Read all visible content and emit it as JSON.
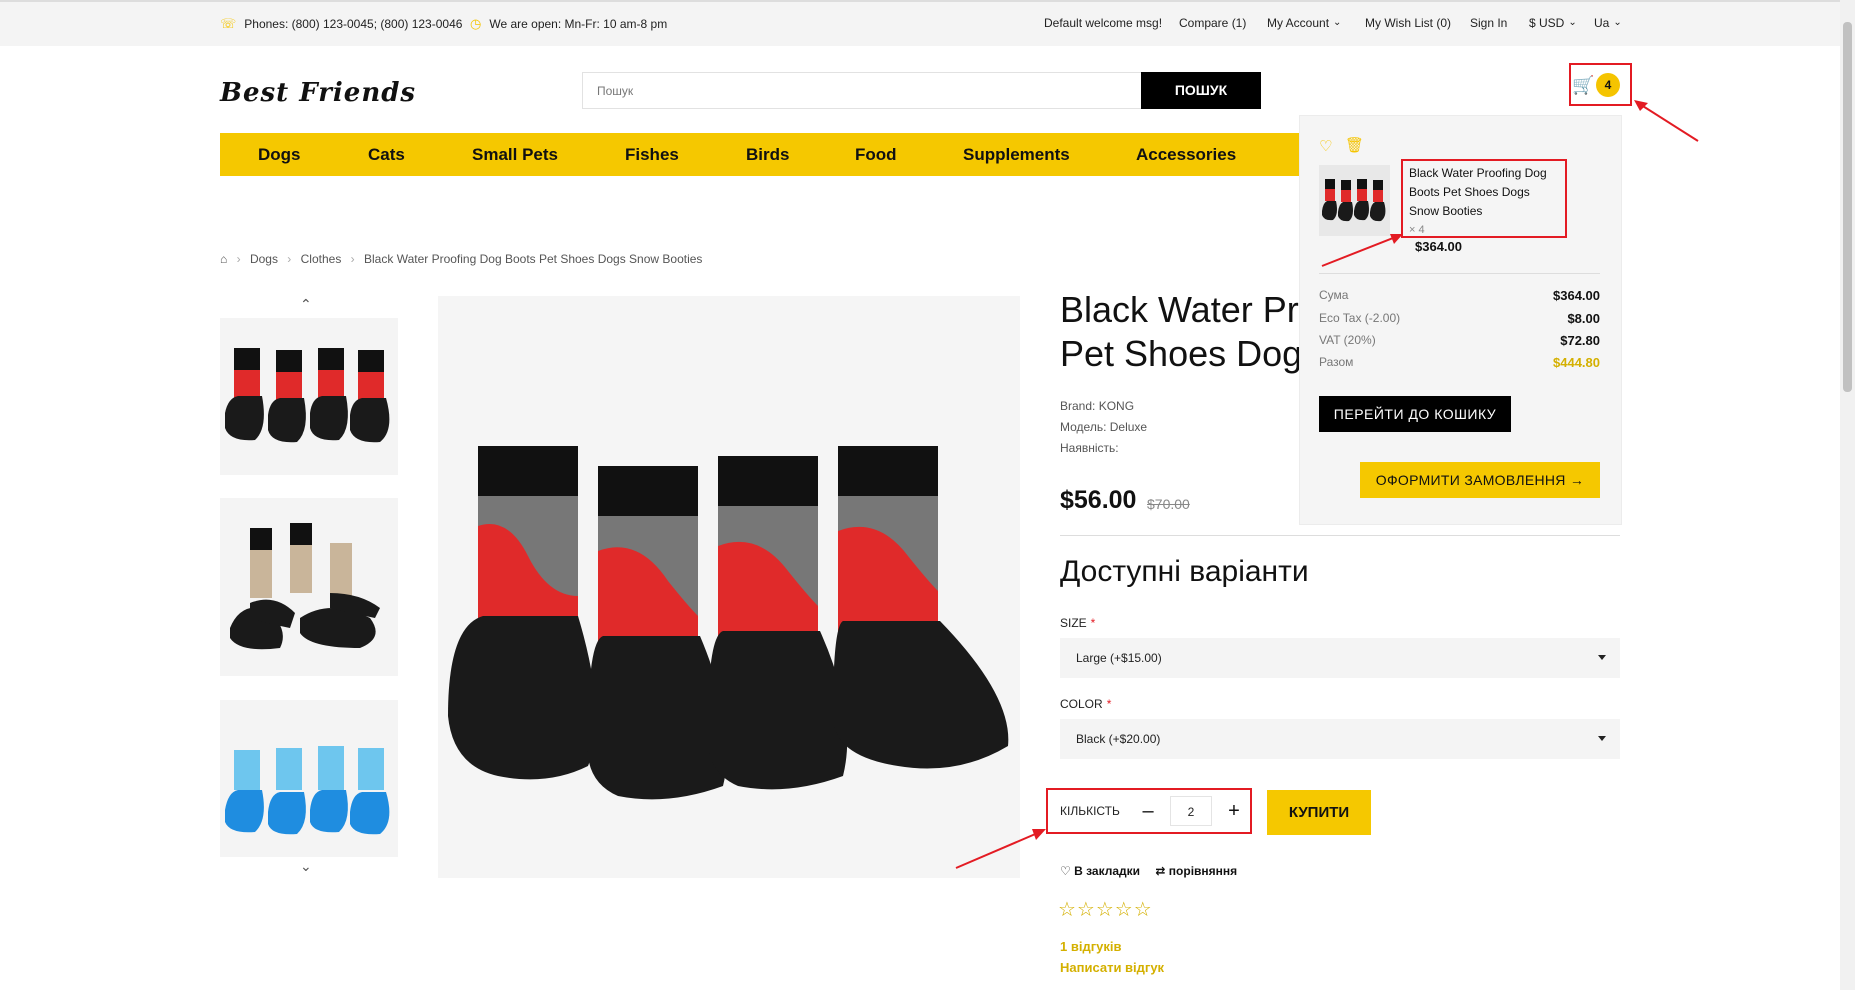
{
  "topbar": {
    "phones": "Phones: (800) 123-0045; (800) 123-0046",
    "hours": "We are open: Mn-Fr: 10 am-8 pm",
    "welcome": "Default welcome msg!",
    "compare": "Compare (1)",
    "account": "My Account",
    "wishlist": "My Wish List (0)",
    "signin": "Sign In",
    "currency": "$ USD",
    "language": "Ua"
  },
  "header": {
    "logo": "Best Friends",
    "search_placeholder": "Пошук",
    "search_button": "ПОШУК",
    "cart_count": "4"
  },
  "nav": [
    "Dogs",
    "Cats",
    "Small Pets",
    "Fishes",
    "Birds",
    "Food",
    "Supplements",
    "Accessories"
  ],
  "breadcrumb": {
    "home_icon": "home-icon",
    "items": [
      "Dogs",
      "Clothes",
      "Black Water Proofing Dog Boots Pet Shoes Dogs Snow Booties"
    ]
  },
  "product": {
    "title_line1": "Black Water Pro",
    "title_line2": "Pet Shoes Dogs",
    "brand": "Brand: KONG",
    "model": "Модель: Deluxe",
    "availability": "Наявність:",
    "price": "$56.00",
    "old_price": "$70.00",
    "options_title": "Доступні варіанти",
    "size_label": "SIZE",
    "size_value": "Large (+$15.00)",
    "color_label": "COLOR",
    "color_value": "Black (+$20.00)",
    "qty_label": "КІЛЬКІСТЬ",
    "qty_value": "2",
    "buy_button": "КУПИТИ",
    "wishlist_link": "В закладки",
    "compare_link": "порівняння",
    "reviews": "1 відгуків",
    "write_review": "Написати відгук",
    "rating": 0
  },
  "cart_dropdown": {
    "item_name": "Black Water Proofing Dog Boots Pet Shoes Dogs Snow Booties",
    "item_qty": "× 4",
    "item_price": "$364.00",
    "totals": [
      {
        "label": "Сума",
        "value": "$364.00"
      },
      {
        "label": "Eco Tax (-2.00)",
        "value": "$8.00"
      },
      {
        "label": "VAT (20%)",
        "value": "$72.80"
      },
      {
        "label": "Разом",
        "value": "$444.80"
      }
    ],
    "cart_button": "ПЕРЕЙТИ ДО КОШИКУ",
    "checkout_button": "ОФОРМИТИ ЗАМОВЛЕННЯ →"
  },
  "colors": {
    "accent": "#f5c800",
    "highlight": "#e31b23",
    "dark": "#000000"
  }
}
